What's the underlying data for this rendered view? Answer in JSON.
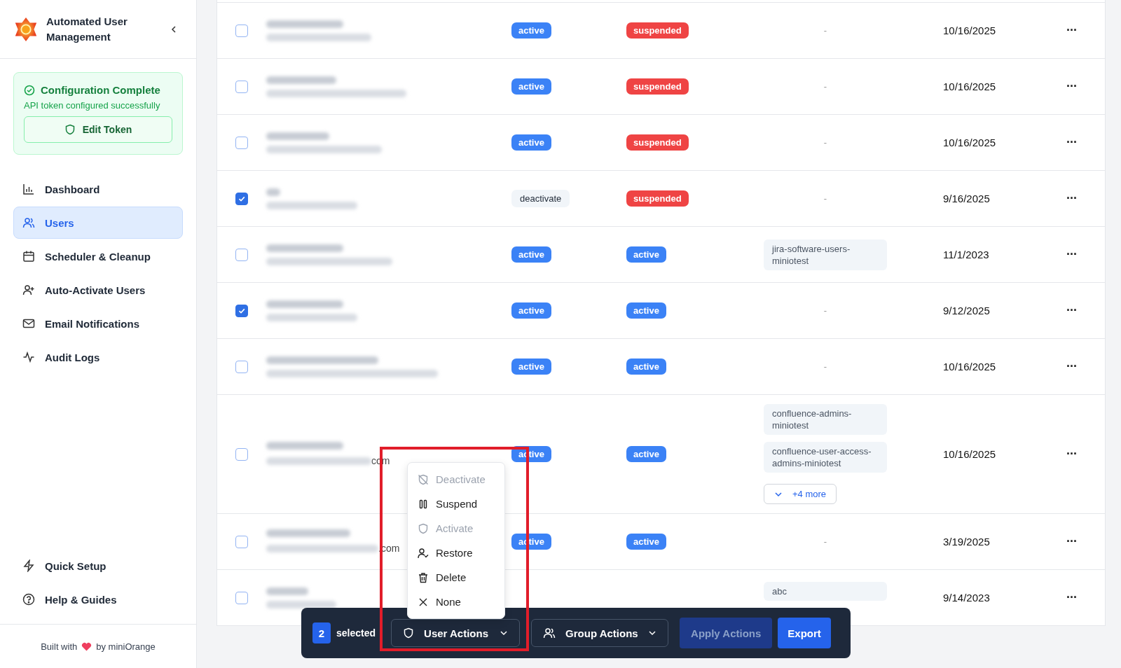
{
  "sidebar": {
    "app_title": "Automated User Management",
    "config_card": {
      "title": "Configuration Complete",
      "message": "API token configured successfully",
      "button": "Edit Token"
    },
    "nav": [
      {
        "label": "Dashboard",
        "selected": false
      },
      {
        "label": "Users",
        "selected": true
      },
      {
        "label": "Scheduler & Cleanup",
        "selected": false
      },
      {
        "label": "Auto-Activate Users",
        "selected": false
      },
      {
        "label": "Email Notifications",
        "selected": false
      },
      {
        "label": "Audit Logs",
        "selected": false
      }
    ],
    "bottom_nav": [
      {
        "label": "Quick Setup"
      },
      {
        "label": "Help & Guides"
      }
    ],
    "footer": {
      "before": "Built with",
      "after": "by miniOrange"
    }
  },
  "table": {
    "rows": [
      {
        "checked": false,
        "status": {
          "text": "active",
          "kind": "active"
        },
        "state": {
          "text": "suspended",
          "kind": "suspended"
        },
        "groups": [],
        "groups_empty": "-",
        "date": "10/16/2025"
      },
      {
        "checked": false,
        "status": {
          "text": "active",
          "kind": "active"
        },
        "state": {
          "text": "suspended",
          "kind": "suspended"
        },
        "groups": [],
        "groups_empty": "-",
        "date": "10/16/2025"
      },
      {
        "checked": false,
        "status": {
          "text": "active",
          "kind": "active"
        },
        "state": {
          "text": "suspended",
          "kind": "suspended"
        },
        "groups": [],
        "groups_empty": "-",
        "date": "10/16/2025"
      },
      {
        "checked": true,
        "status": {
          "text": "deactivate",
          "kind": "deactivated"
        },
        "state": {
          "text": "suspended",
          "kind": "suspended"
        },
        "groups": [],
        "groups_empty": "-",
        "date": "9/16/2025"
      },
      {
        "checked": false,
        "status": {
          "text": "active",
          "kind": "active"
        },
        "state": {
          "text": "active",
          "kind": "active"
        },
        "groups": [
          "jira-software-users-miniotest"
        ],
        "date": "11/1/2023"
      },
      {
        "checked": true,
        "status": {
          "text": "active",
          "kind": "active"
        },
        "state": {
          "text": "active",
          "kind": "active"
        },
        "groups": [],
        "groups_empty": "-",
        "date": "9/12/2025"
      },
      {
        "checked": false,
        "status": {
          "text": "active",
          "kind": "active"
        },
        "state": {
          "text": "active",
          "kind": "active"
        },
        "groups": [],
        "groups_empty": "-",
        "date": "10/16/2025"
      },
      {
        "checked": false,
        "email_tail": "com",
        "status": {
          "text": "active",
          "kind": "active"
        },
        "state": {
          "text": "active",
          "kind": "active"
        },
        "groups": [
          "confluence-admins-miniotest",
          "confluence-user-access-admins-miniotest"
        ],
        "more": "+4 more",
        "date": "10/16/2025"
      },
      {
        "checked": false,
        "email_tail": ".com",
        "status": {
          "text": "active",
          "kind": "active"
        },
        "state": {
          "text": "active",
          "kind": "active"
        },
        "groups": [],
        "groups_empty": "-",
        "date": "3/19/2025"
      },
      {
        "checked": false,
        "groups": [
          "abc"
        ],
        "date": "9/14/2023"
      }
    ],
    "row_menu": "···"
  },
  "user_actions_menu": [
    {
      "label": "Deactivate",
      "disabled": true
    },
    {
      "label": "Suspend",
      "disabled": false
    },
    {
      "label": "Activate",
      "disabled": true
    },
    {
      "label": "Restore",
      "disabled": false
    },
    {
      "label": "Delete",
      "disabled": false
    },
    {
      "label": "None",
      "disabled": false
    }
  ],
  "action_bar": {
    "count": "2",
    "count_label": "selected",
    "user_actions": "User Actions",
    "group_actions": "Group Actions",
    "apply": {
      "label": "Apply Actions",
      "disabled": true
    },
    "export": "Export"
  }
}
